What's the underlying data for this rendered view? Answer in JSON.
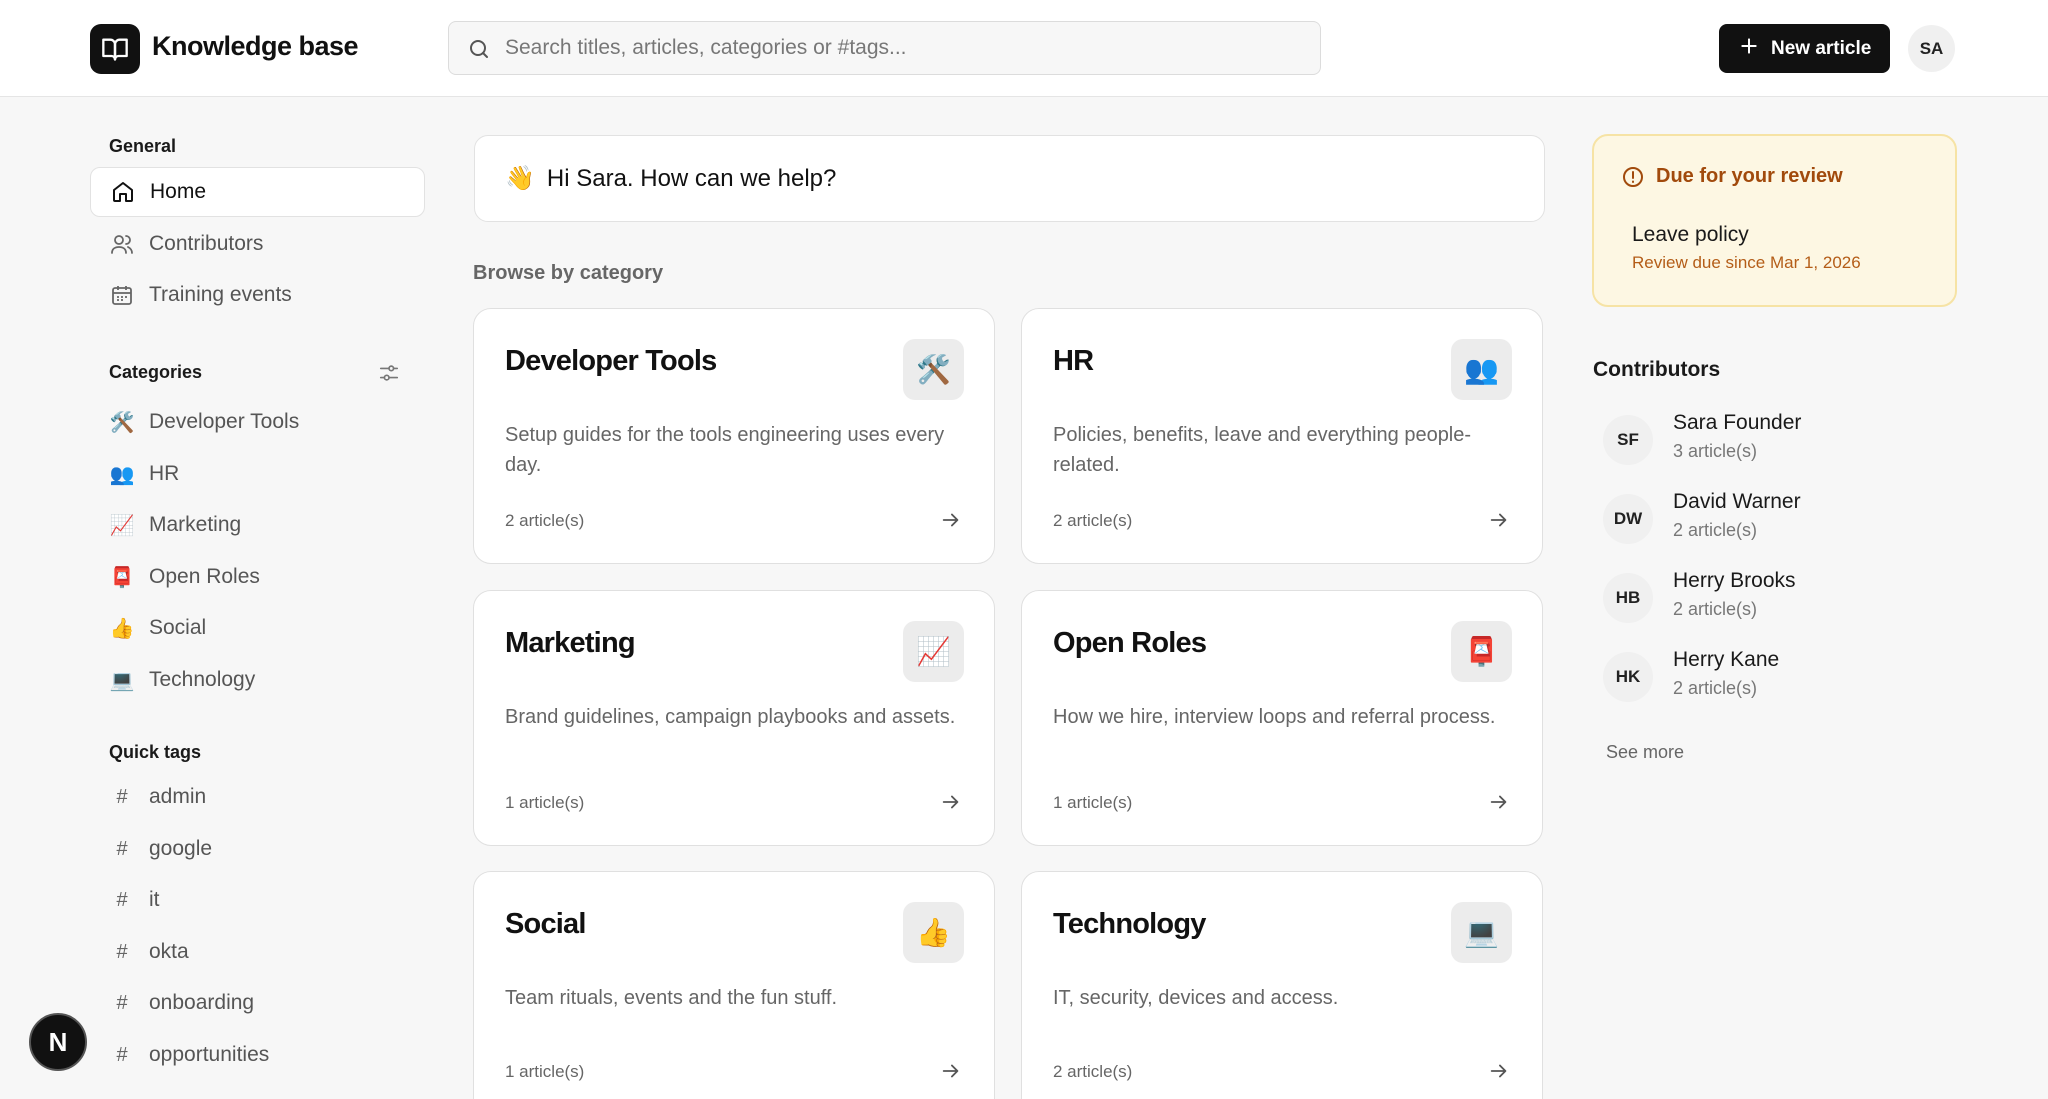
{
  "header": {
    "brand": "Knowledge base",
    "search_placeholder": "Search titles, articles, categories or #tags...",
    "new_article_label": "New article",
    "user_initials": "SA"
  },
  "sidebar": {
    "general_title": "General",
    "general_items": [
      {
        "label": "Home",
        "icon": "home-icon"
      },
      {
        "label": "Contributors",
        "icon": "users-icon"
      },
      {
        "label": "Training events",
        "icon": "calendar-icon"
      }
    ],
    "categories_title": "Categories",
    "categories": [
      {
        "label": "Developer Tools",
        "emoji": "🛠️"
      },
      {
        "label": "HR",
        "emoji": "👥"
      },
      {
        "label": "Marketing",
        "emoji": "📈"
      },
      {
        "label": "Open Roles",
        "emoji": "📮"
      },
      {
        "label": "Social",
        "emoji": "👍"
      },
      {
        "label": "Technology",
        "emoji": "💻"
      }
    ],
    "tags_title": "Quick tags",
    "tags": [
      "admin",
      "google",
      "it",
      "okta",
      "onboarding",
      "opportunities"
    ],
    "hash": "#",
    "badge": "N"
  },
  "main": {
    "greeting_emoji": "👋",
    "greeting": "Hi Sara. How can we help?",
    "browse_title": "Browse by category",
    "cards": [
      {
        "title": "Developer Tools",
        "emoji": "🛠️",
        "desc": "Setup guides for the tools engineering uses every day.",
        "count": "2 article(s)"
      },
      {
        "title": "HR",
        "emoji": "👥",
        "desc": "Policies, benefits, leave and everything people-related.",
        "count": "2 article(s)"
      },
      {
        "title": "Marketing",
        "emoji": "📈",
        "desc": "Brand guidelines, campaign playbooks and assets.",
        "count": "1 article(s)"
      },
      {
        "title": "Open Roles",
        "emoji": "📮",
        "desc": "How we hire, interview loops and referral process.",
        "count": "1 article(s)"
      },
      {
        "title": "Social",
        "emoji": "👍",
        "desc": "Team rituals, events and the fun stuff.",
        "count": "1 article(s)"
      },
      {
        "title": "Technology",
        "emoji": "💻",
        "desc": "IT, security, devices and access.",
        "count": "2 article(s)"
      }
    ]
  },
  "review": {
    "title": "Due for your review",
    "item": "Leave policy",
    "sub": "Review due since Mar 1, 2026"
  },
  "contributors": {
    "title": "Contributors",
    "list": [
      {
        "initials": "SF",
        "name": "Sara Founder",
        "articles": "3 article(s)"
      },
      {
        "initials": "DW",
        "name": "David Warner",
        "articles": "2 article(s)"
      },
      {
        "initials": "HB",
        "name": "Herry Brooks",
        "articles": "2 article(s)"
      },
      {
        "initials": "HK",
        "name": "Herry Kane",
        "articles": "2 article(s)"
      }
    ],
    "see_more": "See more"
  },
  "colors": {
    "accent": "#111111",
    "review_bg": "#fdf7e3",
    "review_title": "#a14a0c"
  }
}
